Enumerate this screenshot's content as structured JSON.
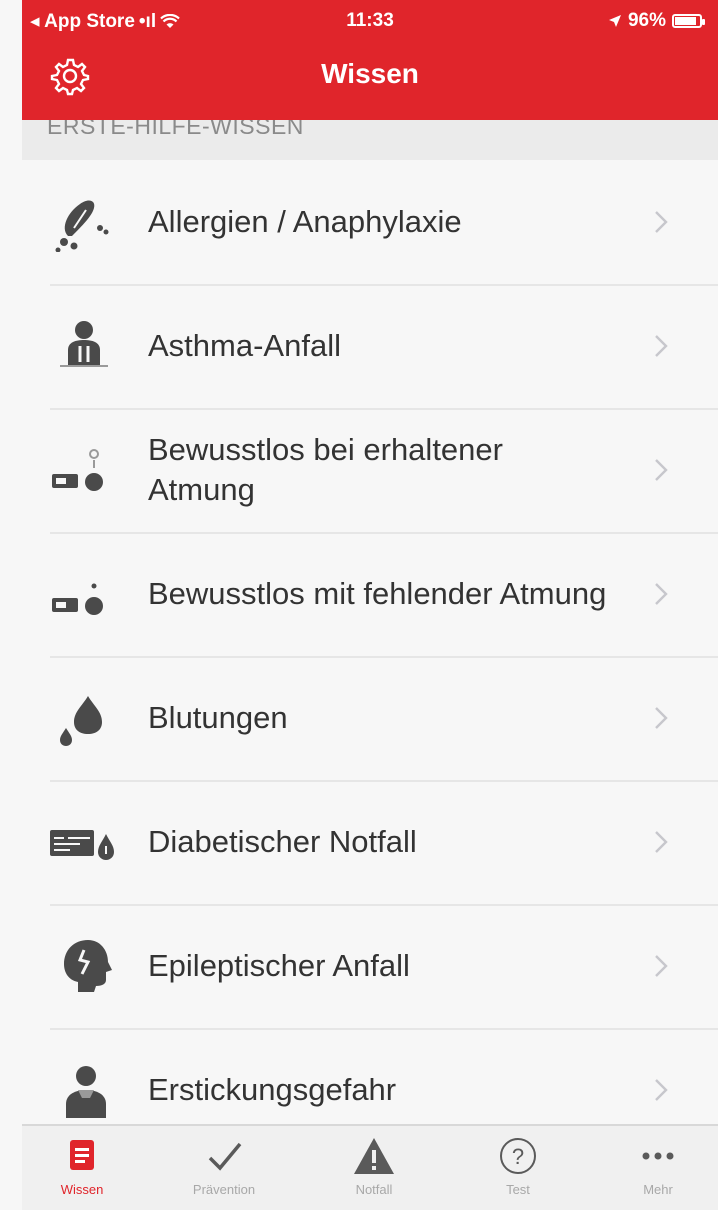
{
  "status_bar": {
    "back_app": "◂ App Store",
    "signal": "•ıl",
    "wifi_icon": "wifi-icon",
    "time": "11:33",
    "battery_percent": "96%",
    "battery_level": 0.96
  },
  "nav": {
    "title": "Wissen",
    "settings_icon": "gear-icon"
  },
  "section": {
    "header": "ERSTE-HILFE-WISSEN"
  },
  "list": {
    "items": [
      {
        "label": "Allergien / Anaphylaxie",
        "icon": "allergy-icon"
      },
      {
        "label": "Asthma-Anfall",
        "icon": "asthma-icon"
      },
      {
        "label": "Bewusstlos bei erhaltener Atmung",
        "icon": "unconscious-breathing-icon"
      },
      {
        "label": "Bewusstlos mit fehlender Atmung",
        "icon": "unconscious-not-breathing-icon"
      },
      {
        "label": "Blutungen",
        "icon": "bleeding-icon"
      },
      {
        "label": "Diabetischer Notfall",
        "icon": "diabetes-icon"
      },
      {
        "label": "Epileptischer Anfall",
        "icon": "epilepsy-icon"
      },
      {
        "label": "Erstickungsgefahr",
        "icon": "choking-icon"
      }
    ]
  },
  "tabbar": {
    "tabs": [
      {
        "label": "Wissen",
        "icon": "book-icon",
        "active": true
      },
      {
        "label": "Prävention",
        "icon": "checkmark-icon",
        "active": false
      },
      {
        "label": "Notfall",
        "icon": "warning-icon",
        "active": false
      },
      {
        "label": "Test",
        "icon": "question-icon",
        "active": false
      },
      {
        "label": "Mehr",
        "icon": "more-icon",
        "active": false
      }
    ]
  },
  "colors": {
    "accent": "#e0252b",
    "icon_gray": "#4a4a4a",
    "chevron": "#c7c7cc"
  }
}
